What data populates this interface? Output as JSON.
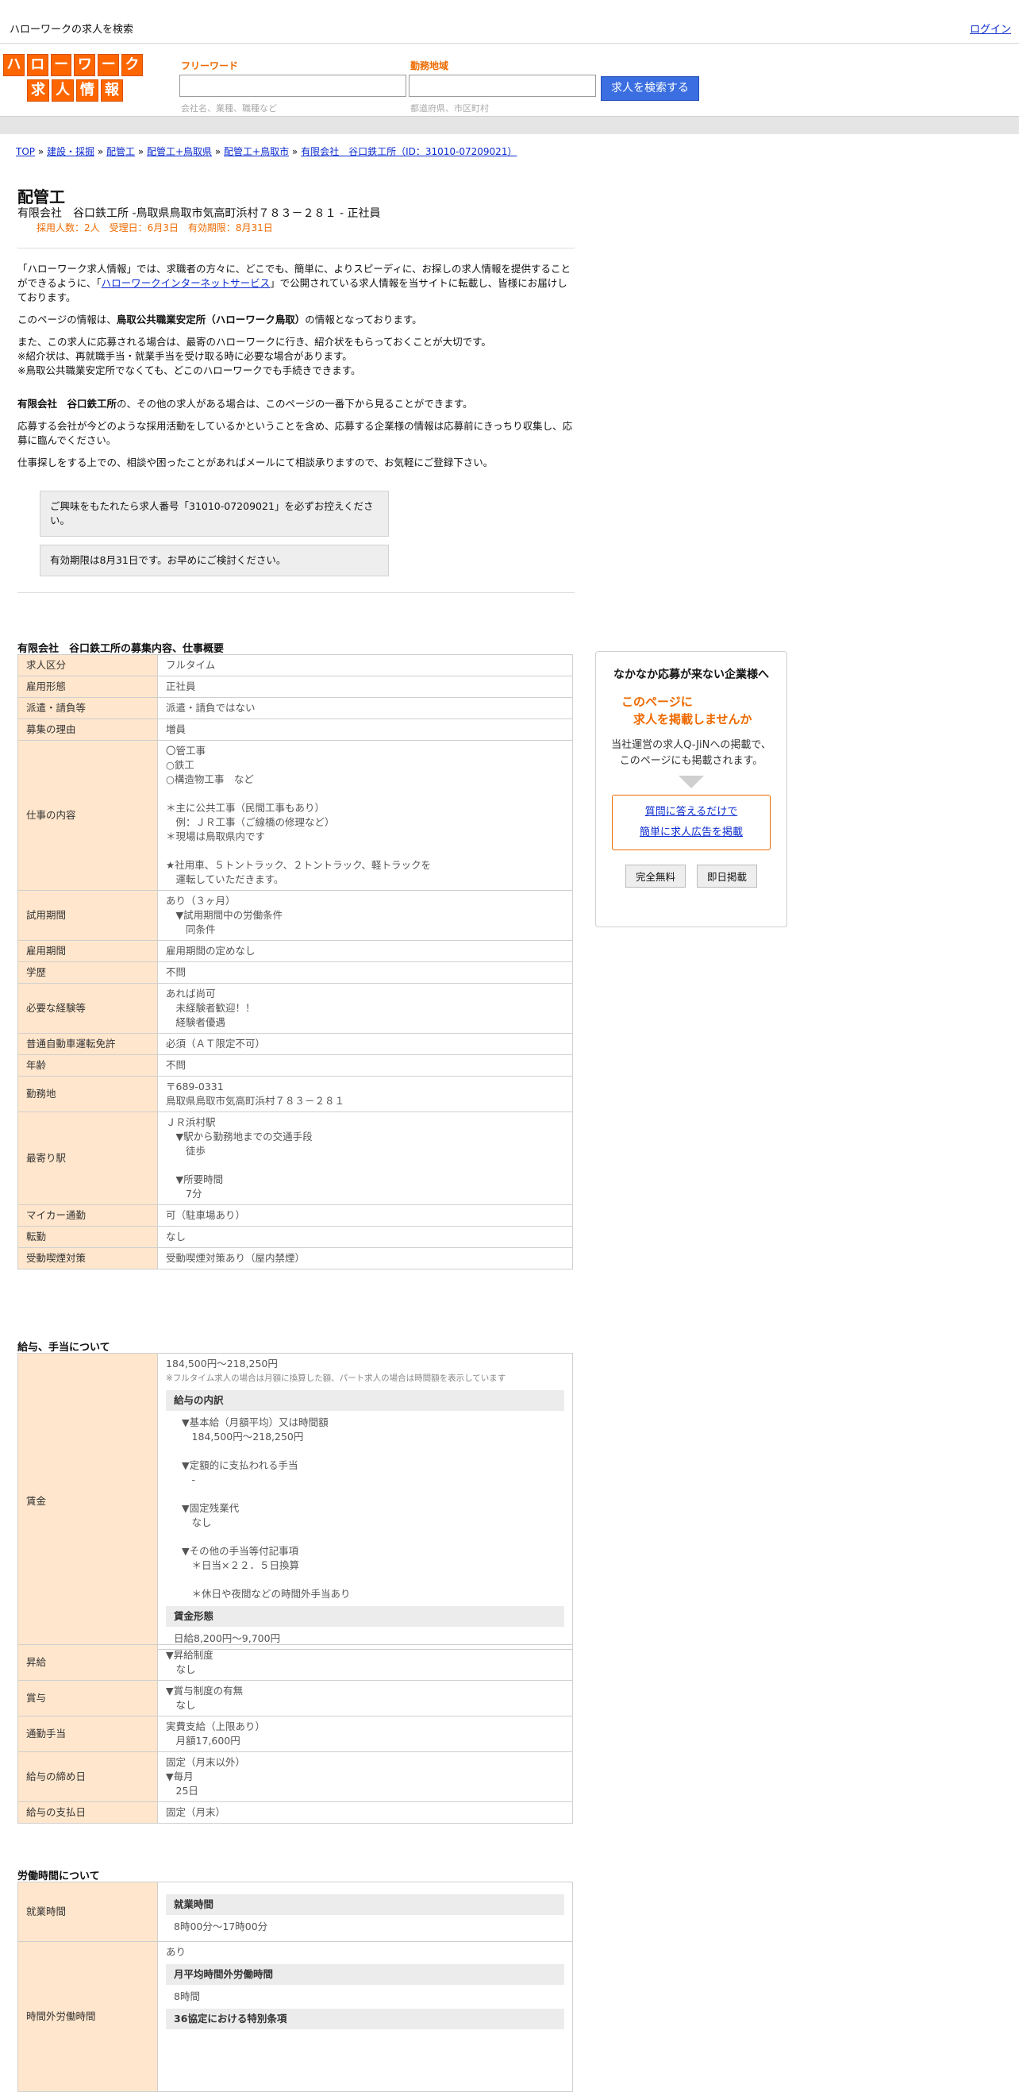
{
  "topbar": {
    "site_title": "ハローワークの求人を検索",
    "login": "ログイン"
  },
  "logo": {
    "row1": [
      "ハ",
      "ロ",
      "ー",
      "ワ",
      "ー",
      "ク"
    ],
    "row2": [
      "求",
      "人",
      "情",
      "報"
    ]
  },
  "search": {
    "freeword_label": "フリーワード",
    "freeword_hint": "会社名、業種、職種など",
    "area_label": "勤務地域",
    "area_hint": "都道府県、市区町村",
    "button": "求人を検索する"
  },
  "breadcrumb": [
    "TOP",
    "建設・採掘",
    "配管工",
    "配管工+鳥取県",
    "配管工+鳥取市",
    "有限会社　谷口鉄工所（ID：31010-07209021）"
  ],
  "job": {
    "title": "配管工",
    "company_line": "有限会社　谷口鉄工所 -鳥取県鳥取市気高町浜村７８３－２８１ - 正社員",
    "meta": "採用人数：2人　受理日：6月3日　有効期限：8月31日"
  },
  "intro": {
    "p1a": "「ハローワーク求人情報」では、求職者の方々に、どこでも、簡単に、よりスピーディに、お探しの求人情報を提供することができるように、「",
    "p1link": "ハローワークインターネットサービス",
    "p1b": "」で公開されている求人情報を当サイトに転載し、皆様にお届けしております。",
    "p2a": "このページの情報は、",
    "p2b": "鳥取公共職業安定所（ハローワーク鳥取）",
    "p2c": "の情報となっております。",
    "p3": "また、この求人に応募される場合は、最寄のハローワークに行き、紹介状をもらっておくことが大切です。",
    "p4": "※紹介状は、再就職手当・就業手当を受け取る時に必要な場合があります。",
    "p5": "※鳥取公共職業安定所でなくても、どこのハローワークでも手続きできます。",
    "p6a": "有限会社　谷口鉄工所",
    "p6b": "の、その他の求人がある場合は、このページの一番下から見ることができます。",
    "p7": "応募する会社が今どのような採用活動をしているかということを含め、応募する企業様の情報は応募前にきっちり収集し、応募に臨んでください。",
    "p8": "仕事探しをする上での、相談や困ったことがあればメールにて相談承りますので、お気軽にご登録下さい。",
    "notice1": "ご興味をもたれたら求人番号「31010-07209021」を必ずお控えください。",
    "notice2": "有効期限は8月31日です。お早めにご検討ください。"
  },
  "section1": {
    "title": "有限会社　谷口鉄工所の募集内容、仕事概要",
    "rows": [
      {
        "h": "求人区分",
        "v": [
          "フルタイム"
        ]
      },
      {
        "h": "雇用形態",
        "v": [
          "正社員"
        ]
      },
      {
        "h": "派遣・請負等",
        "v": [
          "派遣・請負ではない"
        ]
      },
      {
        "h": "募集の理由",
        "v": [
          "増員"
        ]
      },
      {
        "h": "仕事の内容",
        "v": [
          "〇管工事",
          "○鉄工",
          "○構造物工事　など",
          "",
          "＊主に公共工事（民間工事もあり）",
          "　例：ＪＲ工事（ご線橋の修理など）",
          "＊現場は鳥取県内です",
          "",
          "★社用車、５トントラック、２トントラック、軽トラックを",
          "　運転していただきます。"
        ]
      },
      {
        "h": "試用期間",
        "v": [
          "あり（３ヶ月）",
          "　▼試用期間中の労働条件",
          "　　同条件"
        ]
      },
      {
        "h": "雇用期間",
        "v": [
          "雇用期間の定めなし"
        ]
      },
      {
        "h": "学歴",
        "v": [
          "不問"
        ]
      },
      {
        "h": "必要な経験等",
        "v": [
          "あれば尚可",
          "　未経験者歓迎！！",
          "　経験者優遇"
        ]
      },
      {
        "h": "普通自動車運転免許",
        "v": [
          "必須（ＡＴ限定不可）"
        ]
      },
      {
        "h": "年齢",
        "v": [
          "不問"
        ]
      },
      {
        "h": "勤務地",
        "v": [
          "〒689-0331",
          "鳥取県鳥取市気高町浜村７８３－２８１"
        ]
      },
      {
        "h": "最寄り駅",
        "v": [
          "ＪＲ浜村駅",
          "　▼駅から勤務地までの交通手段",
          "　　徒歩",
          "",
          "　▼所要時間",
          "　　7分"
        ]
      },
      {
        "h": "マイカー通勤",
        "v": [
          "可（駐車場あり）"
        ]
      },
      {
        "h": "転勤",
        "v": [
          "なし"
        ]
      },
      {
        "h": "受動喫煙対策",
        "v": [
          "受動喫煙対策あり（屋内禁煙）"
        ]
      }
    ]
  },
  "section2": {
    "title": "給与、手当について",
    "wage": {
      "h": "賃金",
      "range": "184,500円〜218,250円",
      "note": "※フルタイム求人の場合は月額に換算した額、パート求人の場合は時間額を表示しています",
      "sub1": "給与の内訳",
      "lines": [
        "▼基本給（月額平均）又は時間額",
        "　184,500円〜218,250円",
        "",
        "▼定額的に支払われる手当",
        "　-",
        "",
        "▼固定残業代",
        "　なし",
        "",
        "▼その他の手当等付記事項",
        "　＊日当×２２．５日換算",
        "",
        "　＊休日や夜間などの時間外手当あり"
      ],
      "sub2": "賃金形態",
      "form": "日給8,200円〜9,700円"
    },
    "rows": [
      {
        "h": "昇給",
        "v": [
          "▼昇給制度",
          "　なし"
        ]
      },
      {
        "h": "賞与",
        "v": [
          "▼賞与制度の有無",
          "　なし"
        ]
      },
      {
        "h": "通勤手当",
        "v": [
          "実費支給（上限あり）",
          "　月額17,600円"
        ]
      },
      {
        "h": "給与の締め日",
        "v": [
          "固定（月末以外）",
          "▼毎月",
          "　25日"
        ]
      },
      {
        "h": "給与の支払日",
        "v": [
          "固定（月末）"
        ]
      }
    ]
  },
  "section3": {
    "title": "労働時間について",
    "r1h": "就業時間",
    "r1sub": "就業時間",
    "r1v": "8時00分〜17時00分",
    "r2h": "時間外労働時間",
    "r2v": "あり",
    "r2sub": "月平均時間外労働時間",
    "r2v2": "8時間",
    "r2sub2": "36協定における特別条項"
  },
  "ad": {
    "heading": "なかなか応募が来ない企業様へ",
    "orange1": "このページに",
    "orange2": "　求人を掲載しませんか",
    "text1": "当社運営の求人Q-JiNへの掲載で、",
    "text2": "このページにも掲載されます。",
    "link1": "質問に答えるだけで",
    "link2": "簡単に求人広告を掲載",
    "btn1": "完全無料",
    "btn2": "即日掲載"
  }
}
